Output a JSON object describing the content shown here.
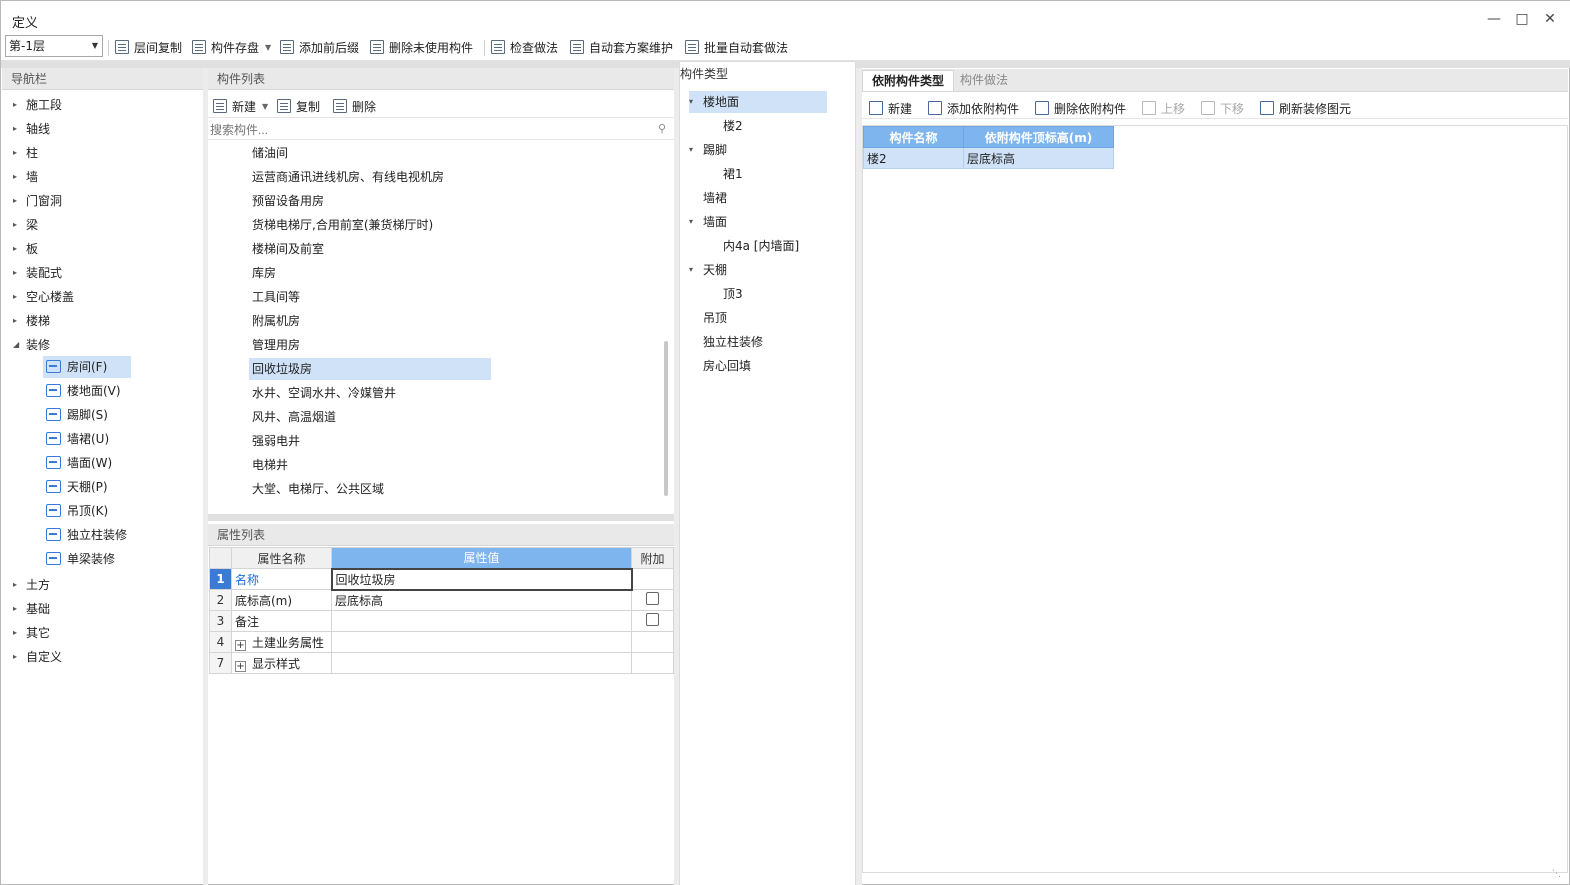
{
  "window": {
    "title": "定义"
  },
  "toolbar": {
    "floor_value": "第-1层",
    "buttons": [
      {
        "label": "层间复制",
        "icon": "copy-floors-icon"
      },
      {
        "label": "构件存盘",
        "icon": "save-component-icon"
      },
      {
        "label": "添加前后缀",
        "icon": "add-affix-icon"
      },
      {
        "label": "删除未使用构件",
        "icon": "delete-unused-icon"
      },
      {
        "label": "检查做法",
        "icon": "check-method-icon"
      },
      {
        "label": "自动套方案维护",
        "icon": "auto-scheme-icon"
      },
      {
        "label": "批量自动套做法",
        "icon": "batch-auto-icon"
      }
    ]
  },
  "nav": {
    "header": "导航栏",
    "items": [
      "施工段",
      "轴线",
      "柱",
      "墙",
      "门窗洞",
      "梁",
      "板",
      "装配式",
      "空心楼盖",
      "楼梯",
      "装修"
    ],
    "decoration_children": [
      "房间(F)",
      "楼地面(V)",
      "踢脚(S)",
      "墙裙(U)",
      "墙面(W)",
      "天棚(P)",
      "吊顶(K)",
      "独立柱装修",
      "单梁装修"
    ],
    "after_items": [
      "土方",
      "基础",
      "其它",
      "自定义"
    ]
  },
  "component_list": {
    "header": "构件列表",
    "new_label": "新建",
    "copy_label": "复制",
    "delete_label": "删除",
    "search_placeholder": "搜索构件...",
    "items": [
      "储油间",
      "运营商通讯进线机房、有线电视机房",
      "预留设备用房",
      "货梯电梯厅,合用前室(兼货梯厅时)",
      "楼梯间及前室",
      "库房",
      "工具间等",
      "附属机房",
      "管理用房",
      "回收垃圾房",
      "水井、空调水井、冷媒管井",
      "风井、高温烟道",
      "强弱电井",
      "电梯井",
      "大堂、电梯厅、公共区域"
    ],
    "selected": "回收垃圾房"
  },
  "properties": {
    "header": "属性列表",
    "col_name": "属性名称",
    "col_value": "属性值",
    "col_extra": "附加",
    "rows": [
      {
        "idx": "1",
        "name": "名称",
        "value": "回收垃圾房"
      },
      {
        "idx": "2",
        "name": "底标高(m)",
        "value": "层底标高"
      },
      {
        "idx": "3",
        "name": "备注",
        "value": ""
      },
      {
        "idx": "4",
        "name": "土建业务属性",
        "value": ""
      },
      {
        "idx": "7",
        "name": "显示样式",
        "value": ""
      }
    ]
  },
  "component_type": {
    "header": "构件类型",
    "tree": [
      {
        "label": "楼地面",
        "children": [
          "楼2"
        ]
      },
      {
        "label": "踢脚",
        "children": [
          "裙1"
        ]
      },
      {
        "label": "墙裙",
        "children": []
      },
      {
        "label": "墙面",
        "children": [
          "内4a [内墙面]"
        ]
      },
      {
        "label": "天棚",
        "children": [
          "顶3"
        ]
      },
      {
        "label": "吊顶",
        "children": []
      },
      {
        "label": "独立柱装修",
        "children": []
      },
      {
        "label": "房心回填",
        "children": []
      }
    ]
  },
  "right_panel": {
    "tabs": [
      "依附构件类型",
      "构件做法"
    ],
    "buttons": {
      "new": "新建",
      "add_dep": "添加依附构件",
      "del_dep": "删除依附构件",
      "up": "上移",
      "down": "下移",
      "refresh": "刷新装修图元"
    },
    "table": {
      "col_name": "构件名称",
      "col_height": "依附构件顶标高(m)",
      "rows": [
        {
          "name": "楼2",
          "height": "层底标高"
        }
      ]
    }
  }
}
